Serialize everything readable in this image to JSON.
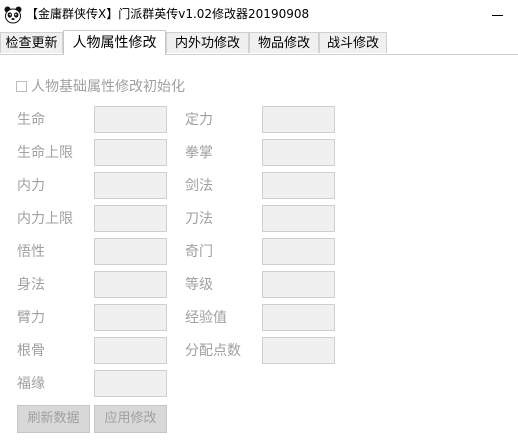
{
  "window": {
    "title": "【金庸群侠传X】门派群英传v1.02修改器20190908",
    "icon": "panda-icon"
  },
  "tabs": [
    {
      "label": "检查更新",
      "active": false
    },
    {
      "label": "人物属性修改",
      "active": true
    },
    {
      "label": "内外功修改",
      "active": false
    },
    {
      "label": "物品修改",
      "active": false
    },
    {
      "label": "战斗修改",
      "active": false
    }
  ],
  "init_checkbox": {
    "label": "人物基础属性修改初始化",
    "checked": false
  },
  "fields_left": [
    {
      "label": "生命",
      "value": ""
    },
    {
      "label": "生命上限",
      "value": ""
    },
    {
      "label": "内力",
      "value": ""
    },
    {
      "label": "内力上限",
      "value": ""
    },
    {
      "label": "悟性",
      "value": ""
    },
    {
      "label": "身法",
      "value": ""
    },
    {
      "label": "臂力",
      "value": ""
    },
    {
      "label": "根骨",
      "value": ""
    },
    {
      "label": "福缘",
      "value": ""
    }
  ],
  "fields_right": [
    {
      "label": "定力",
      "value": ""
    },
    {
      "label": "拳掌",
      "value": ""
    },
    {
      "label": "剑法",
      "value": ""
    },
    {
      "label": "刀法",
      "value": ""
    },
    {
      "label": "奇门",
      "value": ""
    },
    {
      "label": "等级",
      "value": ""
    },
    {
      "label": "经验值",
      "value": ""
    },
    {
      "label": "分配点数",
      "value": ""
    }
  ],
  "buttons": {
    "refresh": "刷新数据",
    "apply": "应用修改"
  }
}
